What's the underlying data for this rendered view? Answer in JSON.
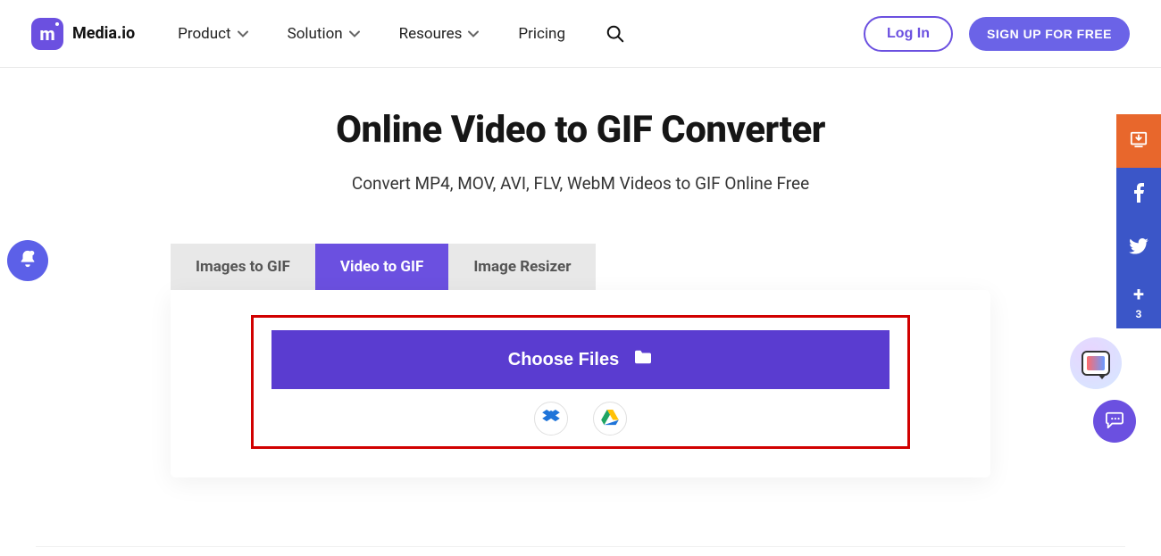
{
  "header": {
    "brand": "Media.io",
    "nav": {
      "product": "Product",
      "solution": "Solution",
      "resources": "Resoures",
      "pricing": "Pricing"
    },
    "login": "Log In",
    "signup": "SIGN UP FOR FREE"
  },
  "main": {
    "title": "Online Video to GIF Converter",
    "subtitle": "Convert MP4, MOV, AVI, FLV, WebM Videos to GIF Online Free"
  },
  "tabs": {
    "images": "Images to GIF",
    "video": "Video to GIF",
    "resizer": "Image Resizer"
  },
  "upload": {
    "choose": "Choose Files"
  },
  "rail": {
    "plus_count": "3"
  }
}
